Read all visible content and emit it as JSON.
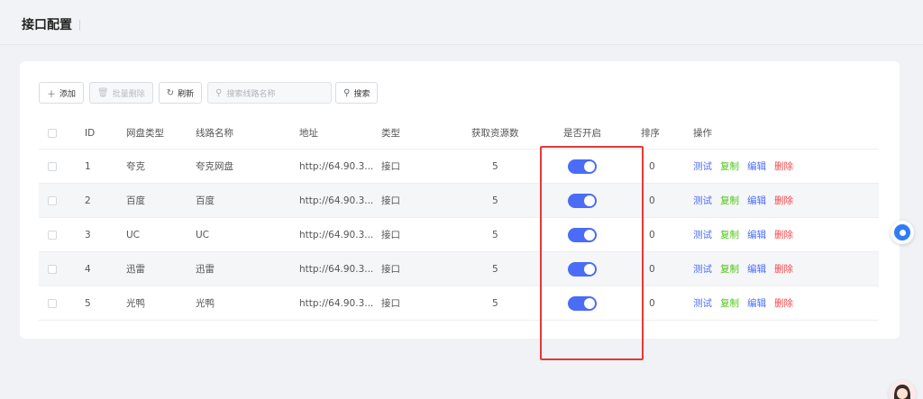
{
  "header": {
    "title": "接口配置"
  },
  "toolbar": {
    "add_label": "添加",
    "batch_delete_label": "批量删除",
    "refresh_label": "刷新",
    "search_placeholder": "搜索线路名称",
    "search_label": "搜索"
  },
  "table": {
    "columns": [
      "ID",
      "网盘类型",
      "线路名称",
      "地址",
      "类型",
      "获取资源数",
      "是否开启",
      "排序",
      "操作"
    ],
    "rows": [
      {
        "id": "1",
        "pan_type": "夸克",
        "name": "夸克网盘",
        "address": "http://64.90.3...",
        "type": "接口",
        "count": "5",
        "enabled": true,
        "sort": "0"
      },
      {
        "id": "2",
        "pan_type": "百度",
        "name": "百度",
        "address": "http://64.90.3...",
        "type": "接口",
        "count": "5",
        "enabled": true,
        "sort": "0"
      },
      {
        "id": "3",
        "pan_type": "UC",
        "name": "UC",
        "address": "http://64.90.3...",
        "type": "接口",
        "count": "5",
        "enabled": true,
        "sort": "0"
      },
      {
        "id": "4",
        "pan_type": "迅雷",
        "name": "迅雷",
        "address": "http://64.90.3...",
        "type": "接口",
        "count": "5",
        "enabled": true,
        "sort": "0"
      },
      {
        "id": "5",
        "pan_type": "光鸭",
        "name": "光鸭",
        "address": "http://64.90.3...",
        "type": "接口",
        "count": "5",
        "enabled": true,
        "sort": "0"
      }
    ],
    "actions": {
      "test": "测试",
      "copy": "复制",
      "edit": "编辑",
      "delete": "删除"
    }
  },
  "colors": {
    "accent": "#4a6cf7",
    "copy": "#52c41a",
    "delete": "#f5484b",
    "highlight": "#e53935"
  },
  "icons": [
    "plus-icon",
    "trash-icon",
    "refresh-icon",
    "search-icon",
    "chat-icon",
    "avatar"
  ]
}
